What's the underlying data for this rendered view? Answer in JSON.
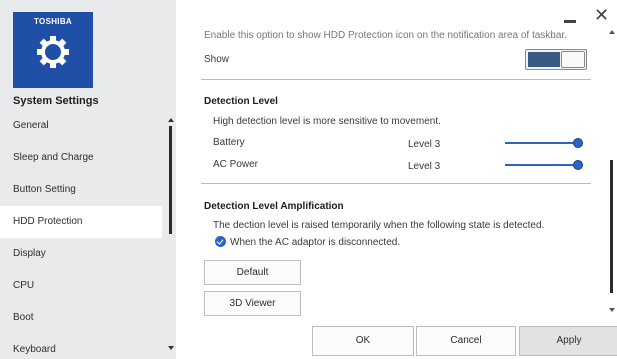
{
  "brand": "TOSHIBA",
  "app_title": "System Settings",
  "nav": [
    {
      "label": "General"
    },
    {
      "label": "Sleep and Charge"
    },
    {
      "label": "Button Setting"
    },
    {
      "label": "HDD Protection",
      "selected": true
    },
    {
      "label": "Display"
    },
    {
      "label": "CPU"
    },
    {
      "label": "Boot"
    },
    {
      "label": "Keyboard"
    }
  ],
  "notification": {
    "description": "Enable this option to show HDD Protection icon on the notification area of taskbar.",
    "show_label": "Show",
    "show_enabled": true
  },
  "detection_level": {
    "heading": "Detection Level",
    "description": "High detection level is more sensitive to movement.",
    "rows": [
      {
        "label": "Battery",
        "value": "Level 3"
      },
      {
        "label": "AC Power",
        "value": "Level 3"
      }
    ]
  },
  "amplification": {
    "heading": "Detection Level Amplification",
    "description": "The dection level is raised temporarily when the following state is detected.",
    "checkbox_label": "When the AC adaptor is disconnected.",
    "checkbox_checked": true
  },
  "buttons": {
    "default": "Default",
    "viewer": "3D Viewer",
    "ok": "OK",
    "cancel": "Cancel",
    "apply": "Apply"
  },
  "colors": {
    "accent": "#2a64c5",
    "logo_bg": "#1f4fa6",
    "sidebar_bg": "#e9eaeb"
  }
}
